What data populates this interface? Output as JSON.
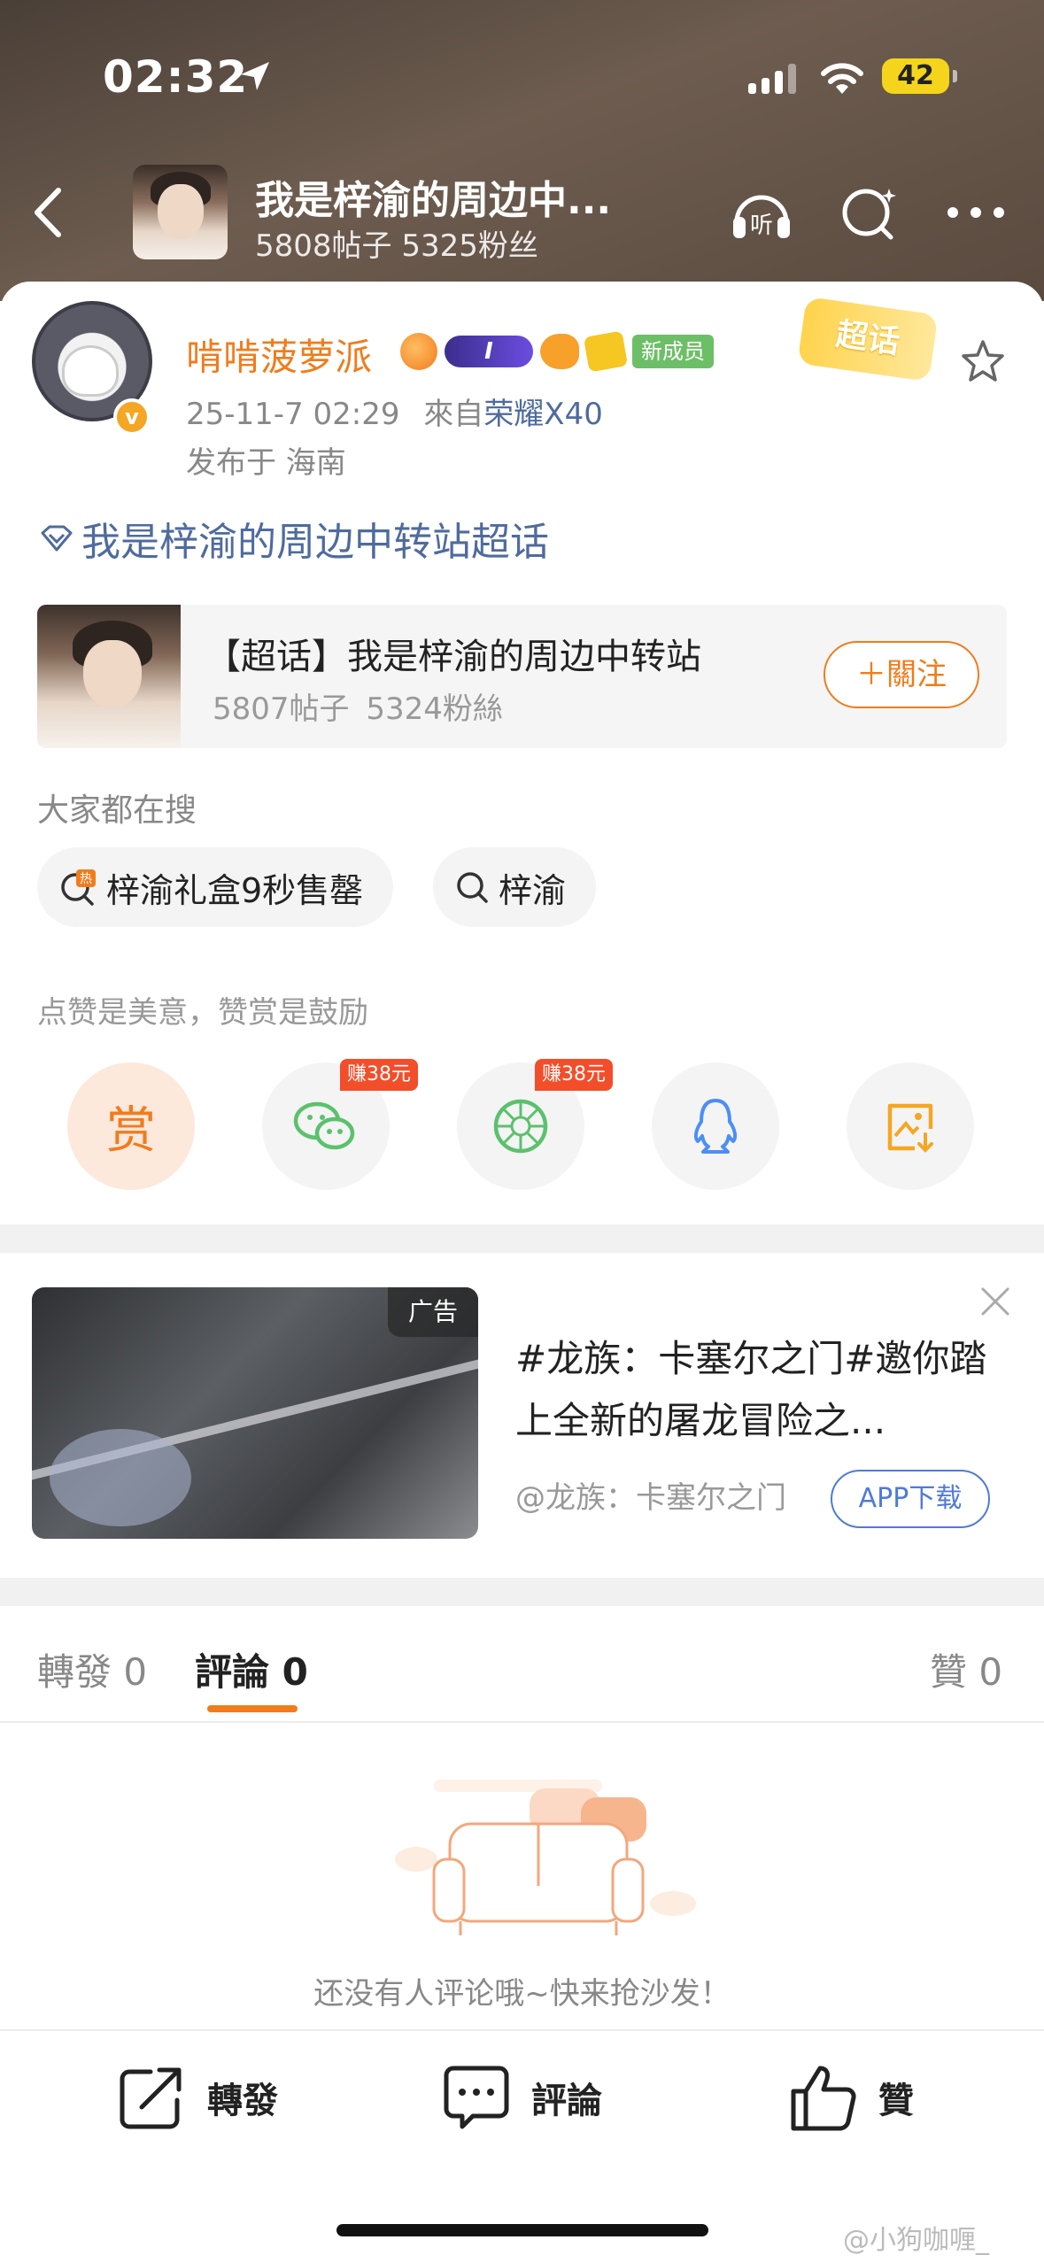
{
  "status_bar": {
    "time": "02:32",
    "battery": "42"
  },
  "header": {
    "title": "我是梓渝的周边中...",
    "posts_count": "5808",
    "posts_label": "帖子",
    "fans_count": "5325",
    "fans_label": "粉丝",
    "listen_label": "听"
  },
  "post": {
    "username": "啃啃菠萝派",
    "level_badge": "I",
    "new_member_badge": "新成员",
    "supertopic_badge": "超话",
    "date": "25-11-7 02:29",
    "from_label": "來自",
    "device": "荣耀X40",
    "location": "发布于 海南",
    "topic_link": "我是梓渝的周边中转站超话"
  },
  "topic_card": {
    "title": "【超话】我是梓渝的周边中转站",
    "posts": "5807帖子",
    "fans": "5324粉絲",
    "follow_label": "＋關注"
  },
  "search": {
    "label": "大家都在搜",
    "chips": [
      {
        "text": "梓渝礼盒9秒售罄",
        "hot": "热"
      },
      {
        "text": "梓渝"
      }
    ]
  },
  "reward": {
    "hint": "点赞是美意，赞赏是鼓励",
    "reward_label": "赏",
    "earn_tags": [
      "赚38元",
      "赚38元"
    ]
  },
  "ad": {
    "tag": "广告",
    "title": "#龙族：卡塞尔之门#邀你踏上全新的屠龙冒险之...",
    "source": "@龙族：卡塞尔之门",
    "button": "APP下载"
  },
  "tabs": {
    "repost_label": "轉發",
    "repost_count": "0",
    "comment_label": "評論",
    "comment_count": "0",
    "like_label": "贊",
    "like_count": "0"
  },
  "empty_state": "还没有人评论哦~快来抢沙发！",
  "bottom_bar": {
    "repost": "轉發",
    "comment": "評論",
    "like": "贊"
  },
  "watermark": "@小狗咖喱_",
  "colors": {
    "accent": "#f07c1c",
    "link": "#4f6b9e",
    "ad_button": "#4f7bd6"
  }
}
